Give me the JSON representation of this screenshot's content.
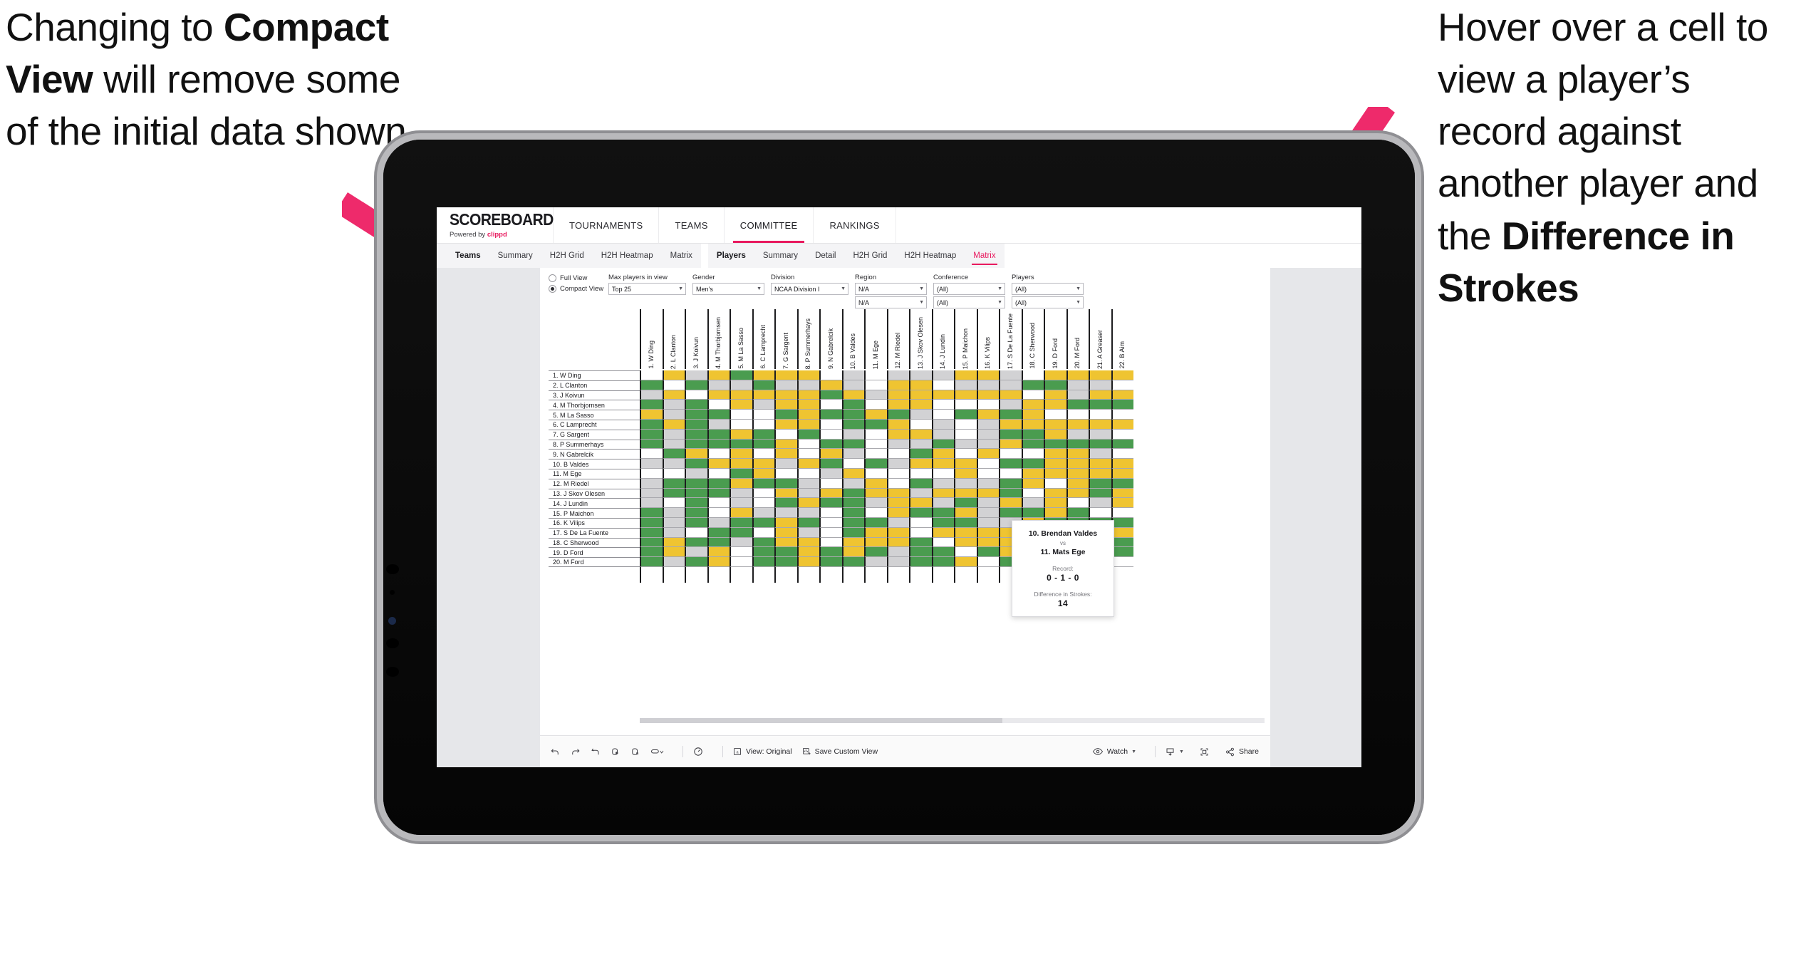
{
  "annotations": {
    "left": {
      "line1": "Changing to ",
      "bold1": "Compact View",
      "line2": " will remove some of the initial data shown"
    },
    "right": {
      "line1": "Hover over a cell to view a player’s record against another player and the ",
      "bold1": "Difference in Strokes"
    },
    "arrow_color": "#ee2a6b"
  },
  "app": {
    "brand": {
      "logo": "SCOREBOARD",
      "powered_prefix": "Powered by ",
      "powered_name": "clippd"
    },
    "topnav": [
      {
        "label": "TOURNAMENTS",
        "active": false
      },
      {
        "label": "TEAMS",
        "active": false
      },
      {
        "label": "COMMITTEE",
        "active": true
      },
      {
        "label": "RANKINGS",
        "active": false
      }
    ],
    "subnav_teams": [
      {
        "label": "Teams",
        "lead": true
      },
      {
        "label": "Summary"
      },
      {
        "label": "H2H Grid"
      },
      {
        "label": "H2H Heatmap"
      },
      {
        "label": "Matrix"
      }
    ],
    "subnav_players": [
      {
        "label": "Players",
        "lead": true
      },
      {
        "label": "Summary"
      },
      {
        "label": "Detail"
      },
      {
        "label": "H2H Grid"
      },
      {
        "label": "H2H Heatmap"
      },
      {
        "label": "Matrix",
        "selected": true
      }
    ]
  },
  "filters": {
    "view_options": [
      {
        "label": "Full View",
        "selected": false
      },
      {
        "label": "Compact View",
        "selected": true
      }
    ],
    "max_players": {
      "label": "Max players in view",
      "value": "Top 25"
    },
    "gender": {
      "label": "Gender",
      "value": "Men’s"
    },
    "division": {
      "label": "Division",
      "value": "NCAA Division I"
    },
    "region": {
      "label": "Region",
      "value1": "N/A",
      "value2": "N/A"
    },
    "conference": {
      "label": "Conference",
      "value1": "(All)",
      "value2": "(All)"
    },
    "players": {
      "label": "Players",
      "value1": "(All)",
      "value2": "(All)"
    }
  },
  "matrix": {
    "columns": [
      "1. W Ding",
      "2. L Clanton",
      "3. J Koivun",
      "4. M Thorbjornsen",
      "5. M La Sasso",
      "6. C Lamprecht",
      "7. G Sargent",
      "8. P Summerhays",
      "9. N Gabrelcik",
      "10. B Valdes",
      "11. M Ege",
      "12. M Riedel",
      "13. J Skov Olesen",
      "14. J Lundin",
      "15. P Maichon",
      "16. K Vilips",
      "17. S De La Fuente",
      "18. C Sherwood",
      "19. D Ford",
      "20. M Ford",
      "21. A Greaser",
      "22. B Aim"
    ],
    "rows": [
      "1. W Ding",
      "2. L Clanton",
      "3. J Koivun",
      "4. M Thorbjornsen",
      "5. M La Sasso",
      "6. C Lamprecht",
      "7. G Sargent",
      "8. P Summerhays",
      "9. N Gabrelcik",
      "10. B Valdes",
      "11. M Ege",
      "12. M Riedel",
      "13. J Skov Olesen",
      "14. J Lundin",
      "15. P Maichon",
      "16. K Vilips",
      "17. S De La Fuente",
      "18. C Sherwood",
      "19. D Ford",
      "20. M Ford"
    ],
    "legend": {
      "win": "#4a9c4f",
      "loss": "#efc431",
      "tie": "#d2d2d4",
      "none": "#ffffff"
    },
    "cells": [
      [
        "w",
        "y",
        "a",
        "y",
        "g",
        "y",
        "y",
        "y",
        "w",
        "a",
        "w",
        "a",
        "a",
        "a",
        "y",
        "y",
        "a",
        "w",
        "y",
        "y",
        "y",
        "y"
      ],
      [
        "g",
        "w",
        "g",
        "a",
        "a",
        "g",
        "a",
        "a",
        "y",
        "a",
        "w",
        "y",
        "y",
        "w",
        "a",
        "a",
        "a",
        "g",
        "g",
        "a",
        "a",
        "w"
      ],
      [
        "a",
        "y",
        "w",
        "y",
        "y",
        "y",
        "y",
        "y",
        "g",
        "y",
        "a",
        "y",
        "y",
        "y",
        "y",
        "y",
        "y",
        "w",
        "y",
        "a",
        "y",
        "y"
      ],
      [
        "g",
        "a",
        "g",
        "w",
        "y",
        "a",
        "y",
        "y",
        "w",
        "g",
        "w",
        "y",
        "y",
        "w",
        "w",
        "w",
        "a",
        "y",
        "y",
        "g",
        "g",
        "g"
      ],
      [
        "y",
        "a",
        "g",
        "g",
        "w",
        "w",
        "g",
        "y",
        "g",
        "g",
        "y",
        "g",
        "a",
        "w",
        "g",
        "y",
        "g",
        "y",
        "w",
        "w",
        "w",
        "w"
      ],
      [
        "g",
        "y",
        "g",
        "a",
        "w",
        "w",
        "y",
        "y",
        "w",
        "g",
        "g",
        "y",
        "w",
        "a",
        "w",
        "a",
        "y",
        "y",
        "y",
        "y",
        "y",
        "y"
      ],
      [
        "g",
        "a",
        "g",
        "g",
        "y",
        "g",
        "w",
        "g",
        "w",
        "a",
        "w",
        "y",
        "y",
        "a",
        "w",
        "a",
        "g",
        "g",
        "y",
        "a",
        "a",
        "w"
      ],
      [
        "g",
        "a",
        "g",
        "g",
        "g",
        "g",
        "y",
        "w",
        "g",
        "g",
        "w",
        "a",
        "a",
        "g",
        "a",
        "a",
        "y",
        "g",
        "g",
        "g",
        "g",
        "g"
      ],
      [
        "w",
        "g",
        "y",
        "w",
        "y",
        "w",
        "y",
        "w",
        "y",
        "a",
        "w",
        "w",
        "g",
        "y",
        "w",
        "y",
        "w",
        "w",
        "y",
        "y",
        "a",
        "w"
      ],
      [
        "a",
        "a",
        "g",
        "y",
        "y",
        "y",
        "a",
        "y",
        "g",
        "w",
        "g",
        "a",
        "y",
        "y",
        "y",
        "w",
        "g",
        "g",
        "y",
        "y",
        "y",
        "y"
      ],
      [
        "w",
        "w",
        "a",
        "w",
        "g",
        "y",
        "w",
        "w",
        "a",
        "y",
        "w",
        "w",
        "w",
        "w",
        "y",
        "w",
        "w",
        "y",
        "y",
        "y",
        "y",
        "y"
      ],
      [
        "a",
        "g",
        "g",
        "g",
        "y",
        "g",
        "g",
        "a",
        "w",
        "a",
        "y",
        "w",
        "g",
        "a",
        "a",
        "a",
        "g",
        "y",
        "w",
        "y",
        "g",
        "g"
      ],
      [
        "a",
        "g",
        "g",
        "g",
        "a",
        "w",
        "y",
        "a",
        "y",
        "g",
        "y",
        "y",
        "a",
        "y",
        "y",
        "y",
        "g",
        "w",
        "y",
        "y",
        "g",
        "y"
      ],
      [
        "a",
        "w",
        "g",
        "w",
        "a",
        "w",
        "g",
        "y",
        "g",
        "g",
        "a",
        "y",
        "y",
        "a",
        "g",
        "a",
        "y",
        "a",
        "y",
        "w",
        "a",
        "y"
      ],
      [
        "g",
        "a",
        "g",
        "w",
        "y",
        "a",
        "a",
        "a",
        "w",
        "g",
        "w",
        "y",
        "g",
        "g",
        "y",
        "a",
        "g",
        "g",
        "y",
        "g",
        "w",
        "w"
      ],
      [
        "g",
        "a",
        "g",
        "a",
        "g",
        "g",
        "y",
        "g",
        "w",
        "g",
        "g",
        "a",
        "w",
        "g",
        "g",
        "a",
        "a",
        "y",
        "g",
        "g",
        "g",
        "g"
      ],
      [
        "g",
        "a",
        "w",
        "g",
        "g",
        "w",
        "y",
        "a",
        "w",
        "g",
        "y",
        "y",
        "w",
        "y",
        "y",
        "y",
        "y",
        "g",
        "y",
        "w",
        "y",
        "y"
      ],
      [
        "g",
        "y",
        "g",
        "g",
        "a",
        "g",
        "y",
        "y",
        "w",
        "y",
        "y",
        "y",
        "g",
        "w",
        "y",
        "y",
        "y",
        "g",
        "a",
        "y",
        "y",
        "g"
      ],
      [
        "g",
        "y",
        "a",
        "y",
        "w",
        "g",
        "g",
        "y",
        "g",
        "y",
        "g",
        "a",
        "g",
        "g",
        "w",
        "g",
        "y",
        "g",
        "y",
        "w",
        "a",
        "g"
      ],
      [
        "g",
        "a",
        "g",
        "y",
        "w",
        "g",
        "g",
        "y",
        "g",
        "g",
        "a",
        "a",
        "g",
        "g",
        "y",
        "w",
        "g",
        "g",
        "a",
        "y",
        "y",
        "w"
      ]
    ]
  },
  "tooltip": {
    "player_a": "10. Brendan Valdes",
    "vs": "vs",
    "player_b": "11. Mats Ege",
    "record_label": "Record:",
    "record_value": "0 - 1 - 0",
    "strokes_label": "Difference in Strokes:",
    "strokes_value": "14"
  },
  "toolbar": {
    "icons": [
      "undo-icon",
      "redo-icon",
      "revert-icon",
      "refresh-icon",
      "pause-icon",
      "pill-icon",
      "chevron-down-icon"
    ],
    "alert_icon": "alert-icon",
    "view_label": "View: Original",
    "view_icon": "view-original-icon",
    "save_label": "Save Custom View",
    "save_icon": "save-view-icon",
    "watch_label": "Watch",
    "watch_icon": "eye-icon",
    "download_icon": "download-icon",
    "fullscreen_icon": "fullscreen-icon",
    "share_label": "Share",
    "share_icon": "share-icon"
  }
}
